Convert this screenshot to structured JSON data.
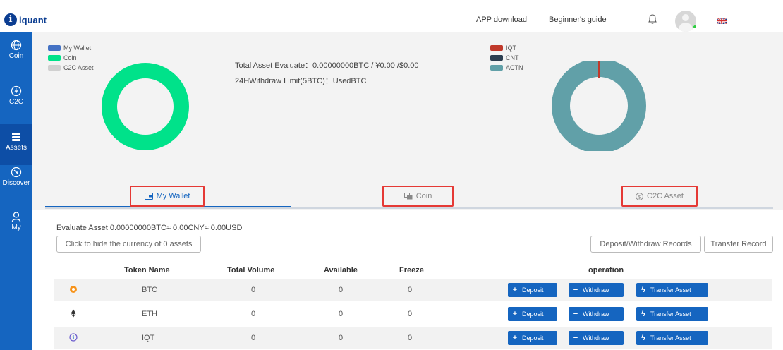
{
  "brand": {
    "name": "iquant"
  },
  "topnav": {
    "app_download": "APP download",
    "beginners_guide": "Beginner's guide"
  },
  "sidebar": {
    "items": [
      {
        "label": "Coin",
        "icon": "globe-icon"
      },
      {
        "label": "C2C",
        "icon": "c2c-icon"
      },
      {
        "label": "Assets",
        "icon": "assets-icon",
        "active": true
      },
      {
        "label": "Discover",
        "icon": "compass-icon"
      },
      {
        "label": "My",
        "icon": "user-icon"
      }
    ]
  },
  "left_chart": {
    "legend": [
      {
        "label": "My Wallet",
        "color": "#4472c4"
      },
      {
        "label": "Coin",
        "color": "#00e28a"
      },
      {
        "label": "C2C Asset",
        "color": "#d0d0d0"
      }
    ],
    "ring_color": "#00e28a"
  },
  "right_chart": {
    "legend": [
      {
        "label": "IQT",
        "color": "#c0392b"
      },
      {
        "label": "CNT",
        "color": "#2c3e50"
      },
      {
        "label": "ACTN",
        "color": "#61a0a8"
      }
    ],
    "ring_color": "#61a0a8",
    "accent_color": "#c0392b"
  },
  "summary": {
    "total_asset": "Total Asset Evaluate：0.00000000BTC / ¥0.00 /$0.00",
    "withdraw_limit": "24HWithdraw Limit(5BTC)：UsedBTC"
  },
  "tabs": [
    {
      "label": "My Wallet",
      "icon": "wallet-icon",
      "active": true
    },
    {
      "label": "Coin",
      "icon": "coin-icon",
      "active": false
    },
    {
      "label": "C2C Asset",
      "icon": "dollar-icon",
      "active": false
    }
  ],
  "wallet": {
    "evaluate": "Evaluate Asset 0.00000000BTC≈ 0.00CNY≈ 0.00USD",
    "hide_zero": "Click to hide the currency of 0 assets",
    "deposit_withdraw_records": "Deposit/Withdraw Records",
    "transfer_record": "Transfer Record"
  },
  "table": {
    "headers": {
      "token": "Token Name",
      "total": "Total Volume",
      "available": "Available",
      "freeze": "Freeze",
      "operation": "operation"
    },
    "rows": [
      {
        "token": "BTC",
        "icon": "btc-icon",
        "total": "0",
        "available": "0",
        "freeze": "0"
      },
      {
        "token": "ETH",
        "icon": "eth-icon",
        "total": "0",
        "available": "0",
        "freeze": "0"
      },
      {
        "token": "IQT",
        "icon": "iqt-icon",
        "total": "0",
        "available": "0",
        "freeze": "0"
      }
    ],
    "actions": {
      "deposit": "Deposit",
      "withdraw": "Withdraw",
      "transfer": "Transfer Asset"
    }
  }
}
